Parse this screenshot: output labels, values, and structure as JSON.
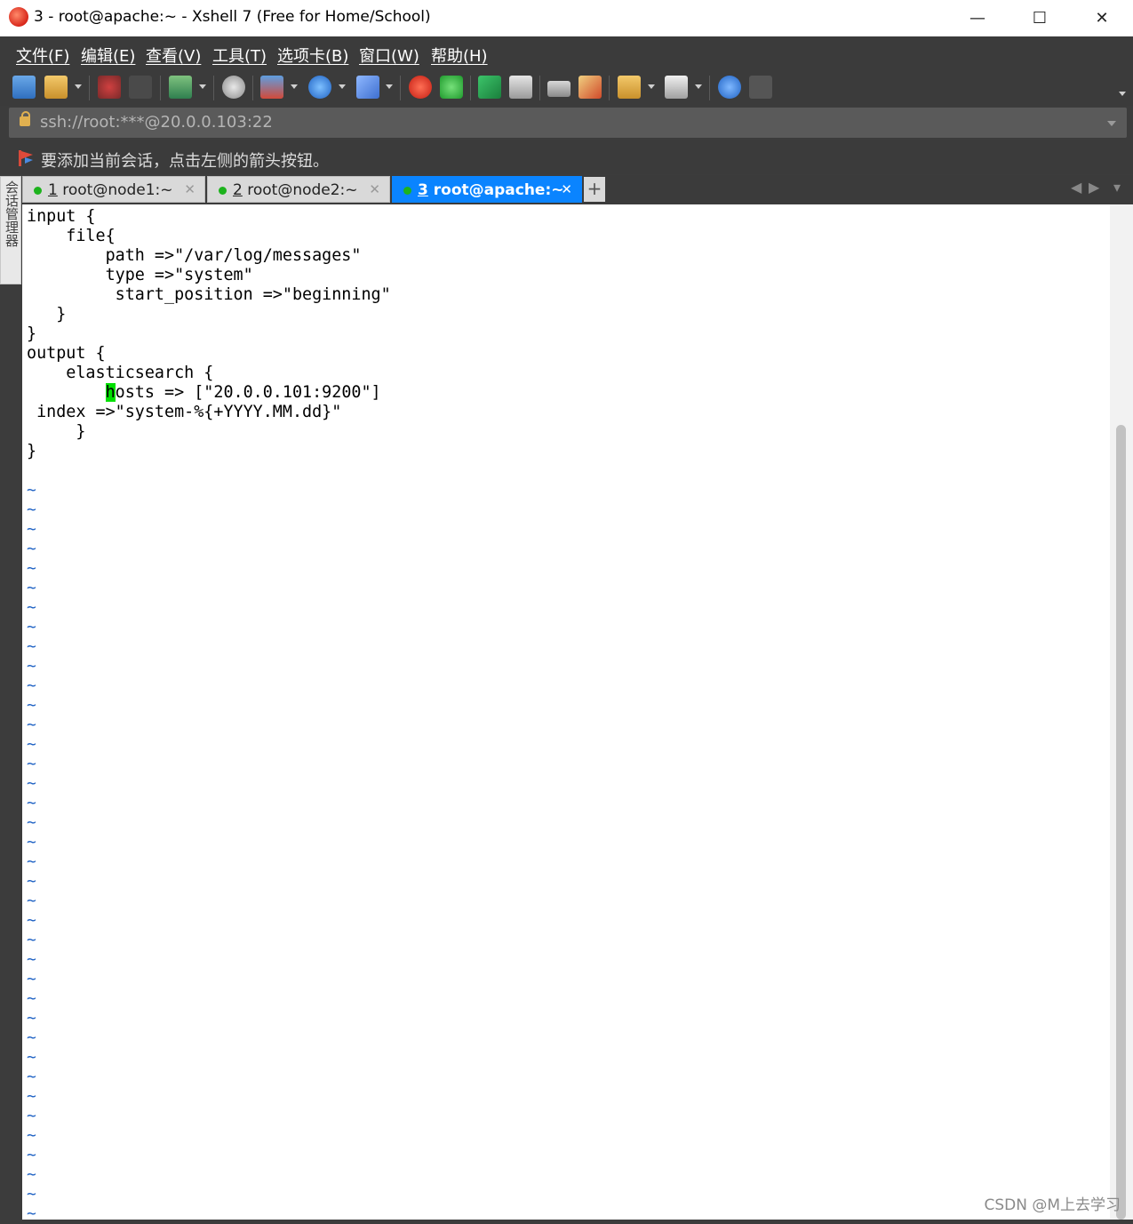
{
  "window": {
    "title": "3 - root@apache:~ - Xshell 7 (Free for Home/School)",
    "minimize": "—",
    "maximize": "☐",
    "close": "✕"
  },
  "menu": {
    "items": [
      "文件(F)",
      "编辑(E)",
      "查看(V)",
      "工具(T)",
      "选项卡(B)",
      "窗口(W)",
      "帮助(H)"
    ]
  },
  "toolbar": {
    "icons": [
      "new-session-icon",
      "open-folder-icon",
      "disconnect-icon",
      "reconnect-icon",
      "new-tab-icon",
      "find-icon",
      "transfer-icon",
      "globe-icon",
      "font-icon",
      "xshell-icon",
      "xftp-icon",
      "fullscreen-icon",
      "lock-icon",
      "keyboard-icon",
      "highlight-icon",
      "compose-icon",
      "layout-icon",
      "help-icon",
      "chat-icon"
    ]
  },
  "address": {
    "value": "ssh://root:***@20.0.0.103:22"
  },
  "hint": {
    "text": "要添加当前会话，点击左侧的箭头按钮。"
  },
  "side_panel": {
    "label": "会话管理器"
  },
  "tabs": [
    {
      "num": "1",
      "label": " root@node1:~",
      "active": false
    },
    {
      "num": "2",
      "label": " root@node2:~",
      "active": false
    },
    {
      "num": "3",
      "label": " root@apache:~",
      "active": true
    }
  ],
  "tab_add": "+",
  "terminal": {
    "before_cursor": "input {\n    file{\n        path =>\"/var/log/messages\"\n        type =>\"system\"\n         start_position =>\"beginning\"\n   }\n}\noutput {\n    elasticsearch {\n        ",
    "cursor_char": "h",
    "after_cursor": "osts => [\"20.0.0.101:9200\"]\n index =>\"system-%{+YYYY.MM.dd}\"\n     }\n}",
    "tilde_line": "~",
    "tilde_count": 38
  },
  "watermark": "CSDN @M上去学习"
}
